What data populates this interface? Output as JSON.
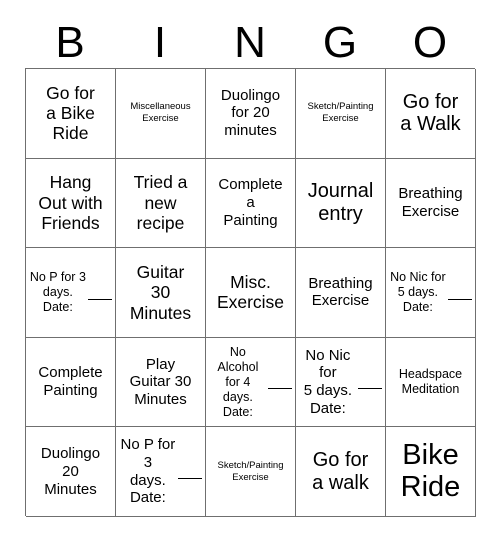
{
  "header": {
    "letters": [
      "B",
      "I",
      "N",
      "G",
      "O"
    ]
  },
  "grid": {
    "rows": [
      [
        {
          "text": "Go for\na Bike\nRide",
          "size": "lg"
        },
        {
          "text": "Miscellaneous\nExercise",
          "size": "xs"
        },
        {
          "text": "Duolingo\nfor 20\nminutes",
          "size": "md"
        },
        {
          "text": "Sketch/Painting\nExercise",
          "size": "xs"
        },
        {
          "text": "Go for\na Walk",
          "size": "xl"
        }
      ],
      [
        {
          "text": "Hang\nOut with\nFriends",
          "size": "lg"
        },
        {
          "text": "Tried a\nnew\nrecipe",
          "size": "lg"
        },
        {
          "text": "Complete\na\nPainting",
          "size": "md"
        },
        {
          "text": "Journal\nentry",
          "size": "xl"
        },
        {
          "text": "Breathing\nExercise",
          "size": "md"
        }
      ],
      [
        {
          "text": "No P for 3\ndays.\nDate:",
          "size": "sm",
          "blank": true
        },
        {
          "text": "Guitar\n30\nMinutes",
          "size": "lg"
        },
        {
          "text": "Misc.\nExercise",
          "size": "lg"
        },
        {
          "text": "Breathing\nExercise",
          "size": "md"
        },
        {
          "text": "No Nic for\n5 days.\nDate:",
          "size": "sm",
          "blank": true
        }
      ],
      [
        {
          "text": "Complete\nPainting",
          "size": "md"
        },
        {
          "text": "Play\nGuitar 30\nMinutes",
          "size": "md"
        },
        {
          "text": "No Alcohol\nfor 4 days.\nDate:",
          "size": "sm",
          "blank": true
        },
        {
          "text": "No Nic for\n5 days.\nDate:",
          "size": "md",
          "blank": true
        },
        {
          "text": "Headspace\nMeditation",
          "size": "sm"
        }
      ],
      [
        {
          "text": "Duolingo\n20\nMinutes",
          "size": "md"
        },
        {
          "text": "No P for 3\ndays.\nDate:",
          "size": "md",
          "blank": true
        },
        {
          "text": "Sketch/Painting\nExercise",
          "size": "xs"
        },
        {
          "text": "Go for\na walk",
          "size": "xl"
        },
        {
          "text": "Bike\nRide",
          "size": "xxl"
        }
      ]
    ]
  },
  "colors": {
    "background": "#ffffff",
    "text": "#000000",
    "grid_line": "#6f6f6f"
  }
}
